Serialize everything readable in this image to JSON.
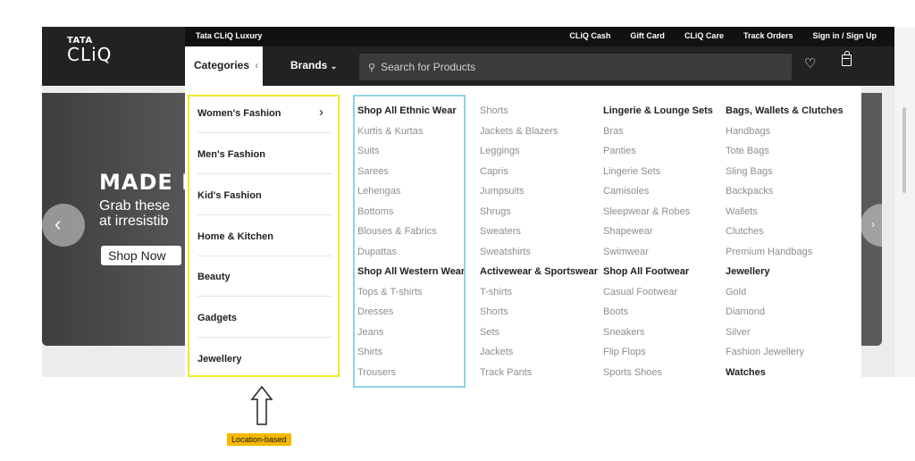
{
  "header": {
    "logo_top": "TATA",
    "logo_bottom": "CLiQ",
    "luxury_link": "Tata CLiQ Luxury",
    "top_links": [
      "CLiQ Cash",
      "Gift Card",
      "CLiQ Care",
      "Track Orders",
      "Sign in / Sign Up"
    ],
    "categories_label": "Categories",
    "brands_label": "Brands",
    "search_placeholder": "Search for Products",
    "icons": [
      "search-icon",
      "heart-icon",
      "bag-icon"
    ]
  },
  "banner": {
    "headline": "MADE F",
    "subline_1": "Grab these",
    "subline_2": "at irresistib",
    "cta": "Shop Now"
  },
  "menu": {
    "categories": [
      "Women's Fashion",
      "Men's Fashion",
      "Kid's Fashion",
      "Home & Kitchen",
      "Beauty",
      "Gadgets",
      "Jewellery"
    ],
    "columns": [
      [
        {
          "text": "Shop All Ethnic Wear",
          "head": true
        },
        {
          "text": "Kurtis & Kurtas"
        },
        {
          "text": "Suits"
        },
        {
          "text": "Sarees"
        },
        {
          "text": "Lehengas"
        },
        {
          "text": "Bottoms"
        },
        {
          "text": "Blouses & Fabrics"
        },
        {
          "text": "Dupattas"
        },
        {
          "text": "Shop All Western Wear",
          "head": true
        },
        {
          "text": "Tops & T-shirts"
        },
        {
          "text": "Dresses"
        },
        {
          "text": "Jeans"
        },
        {
          "text": "Shirts"
        },
        {
          "text": "Trousers"
        }
      ],
      [
        {
          "text": "Shorts"
        },
        {
          "text": "Jackets & Blazers"
        },
        {
          "text": "Leggings"
        },
        {
          "text": "Capris"
        },
        {
          "text": "Jumpsuits"
        },
        {
          "text": "Shrugs"
        },
        {
          "text": "Sweaters"
        },
        {
          "text": "Sweatshirts"
        },
        {
          "text": "Activewear & Sportswear",
          "head": true
        },
        {
          "text": "T-shirts"
        },
        {
          "text": "Shorts"
        },
        {
          "text": "Sets"
        },
        {
          "text": "Jackets"
        },
        {
          "text": "Track Pants"
        }
      ],
      [
        {
          "text": "Lingerie & Lounge Sets",
          "head": true
        },
        {
          "text": "Bras"
        },
        {
          "text": "Panties"
        },
        {
          "text": "Lingerie Sets"
        },
        {
          "text": "Camisoles"
        },
        {
          "text": "Sleepwear & Robes"
        },
        {
          "text": "Shapewear"
        },
        {
          "text": "Swimwear"
        },
        {
          "text": "Shop All Footwear",
          "head": true
        },
        {
          "text": "Casual Footwear"
        },
        {
          "text": "Boots"
        },
        {
          "text": "Sneakers"
        },
        {
          "text": "Flip Flops"
        },
        {
          "text": "Sports Shoes"
        }
      ],
      [
        {
          "text": "Bags, Wallets & Clutches",
          "head": true
        },
        {
          "text": "Handbags"
        },
        {
          "text": "Tote Bags"
        },
        {
          "text": "Sling Bags"
        },
        {
          "text": "Backpacks"
        },
        {
          "text": "Wallets"
        },
        {
          "text": "Clutches"
        },
        {
          "text": "Premium Handbags"
        },
        {
          "text": "Jewellery",
          "head": true
        },
        {
          "text": "Gold"
        },
        {
          "text": "Diamond"
        },
        {
          "text": "Silver"
        },
        {
          "text": "Fashion Jewellery"
        },
        {
          "text": "Watches",
          "head": true
        }
      ]
    ]
  },
  "annotation": {
    "tag_label": "Location-based"
  },
  "colors": {
    "header_bg": "#222222",
    "highlight_yellow": "#f3e72c",
    "highlight_blue": "#8fd3e4",
    "tag_bg": "#f4b800"
  }
}
